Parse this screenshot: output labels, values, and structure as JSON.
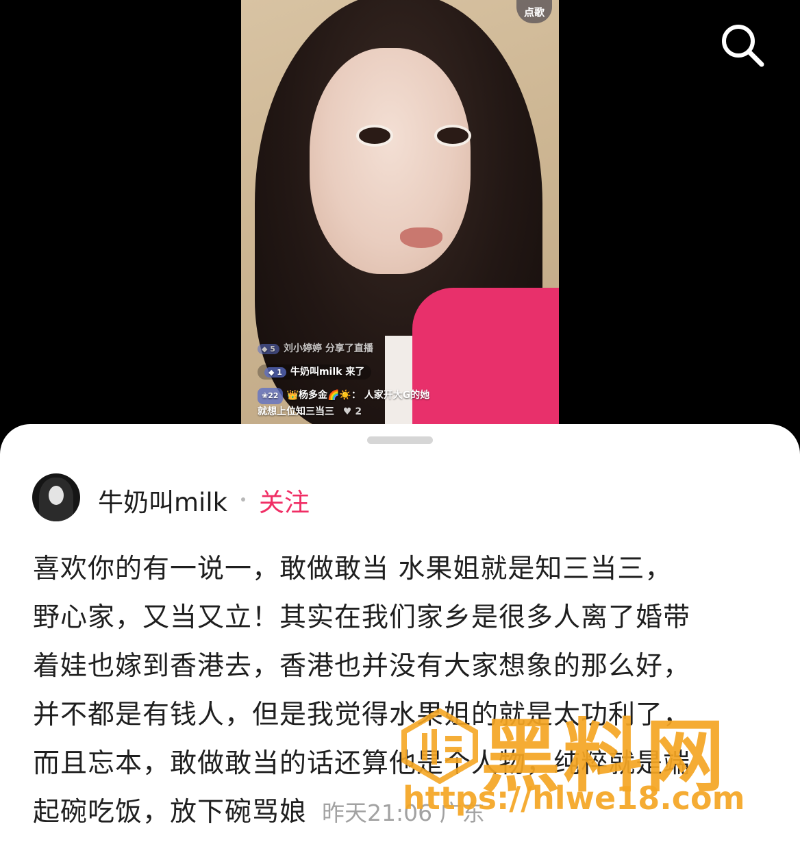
{
  "video": {
    "song_button": "点歌",
    "messages": [
      {
        "level": "5",
        "text": "刘小婷婷 分享了直播"
      },
      {
        "level": "1",
        "text": "牛奶叫milk 来了"
      },
      {
        "level": "22",
        "user": "👑杨多金🌈☀️：",
        "text": "人家开大G的她",
        "text2": "就想上位知三当三",
        "likes": "2"
      }
    ]
  },
  "header": {
    "search_icon": "search-icon"
  },
  "comment": {
    "username": "牛奶叫milk",
    "follow_label": "关注",
    "lines": [
      "喜欢你的有一说一，敢做敢当 水果姐就是知三当三，",
      "野心家，又当又立！其实在我们家乡是很多人离了婚带",
      "着娃也嫁到香港去，香港也并没有大家想象的那么好，",
      "并不都是有钱人，但是我觉得水果姐的就是太功利了，",
      "而且忘本，敢做敢当的话还算他是个人物，纯粹就是端",
      "起碗吃饭，放下碗骂娘"
    ],
    "meta": "昨天21:06 广东"
  },
  "watermark": {
    "title": "黑料网",
    "url": "https://hlwe18.com",
    "color": "#f5a623"
  }
}
